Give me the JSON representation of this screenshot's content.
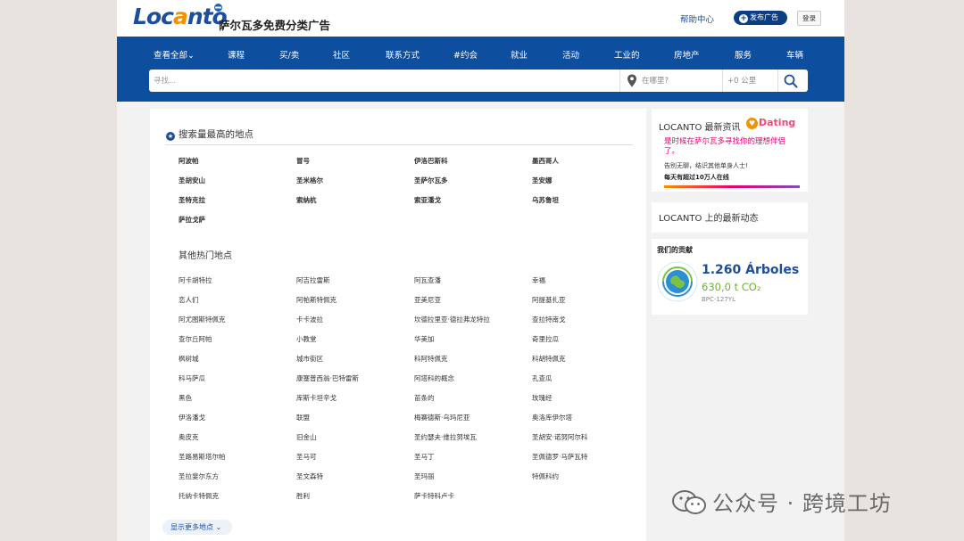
{
  "header": {
    "logo_text_a": "Loc",
    "logo_text_b": "a",
    "logo_text_c": "nto",
    "tagline": "萨尔瓦多免费分类广告",
    "help_link": "帮助中心",
    "post_ad_label": "发布广告",
    "login_label": "登录"
  },
  "nav": {
    "items": [
      "查看全部",
      "课程",
      "买/卖",
      "社区",
      "联系方式",
      "#约会",
      "就业",
      "活动",
      "工业的",
      "房地产",
      "服务",
      "车辆"
    ]
  },
  "search": {
    "query_placeholder": "寻找...",
    "location_placeholder": "在哪里?",
    "radius_label": "+0 公里"
  },
  "popular": {
    "title": "搜索量最高的地点",
    "places": [
      "阿波帕",
      "冒号",
      "伊洛巴斯科",
      "墨西哥人",
      "圣胡安山",
      "圣米格尔",
      "圣萨尔瓦多",
      "圣安娜",
      "圣特克拉",
      "索纳杭",
      "索亚潘戈",
      "乌苏鲁坦",
      "萨拉戈萨"
    ]
  },
  "other": {
    "title": "其他热门地点",
    "places": [
      "阿卡胡特拉",
      "阿吉拉雷斯",
      "阿瓦查潘",
      "幸福",
      "恋人们",
      "阿帕斯特佩克",
      "亚美尼亚",
      "阿提基扎亚",
      "阿尤图斯特佩克",
      "卡卡波拉",
      "坎德拉里亚·德拉弗龙特拉",
      "查拉特南戈",
      "查尔丘阿帕",
      "小教堂",
      "华美加",
      "奇里拉瓜",
      "枫树城",
      "城市街区",
      "科阿特佩克",
      "科胡特佩克",
      "科马萨瓜",
      "康塞普西翁·巴特雷斯",
      "阿塔科的概念",
      "孔查瓜",
      "黑色",
      "库斯卡坦辛戈",
      "苗条的",
      "玫瑰经",
      "伊洛潘戈",
      "联盟",
      "梅赛德斯·乌玛尼亚",
      "奥洛库伊尔塔",
      "奥皮克",
      "旧金山",
      "圣约瑟夫·维拉努埃瓦",
      "圣胡安·诺努阿尔科",
      "圣路易斯塔尔帕",
      "圣马可",
      "圣马丁",
      "圣佩德罗·马萨瓦特",
      "圣拉斐尔东方",
      "圣文森特",
      "圣玛丽",
      "特佩科约",
      "托纳卡特佩克",
      "胜利",
      "萨卡特科卢卡",
      ""
    ],
    "more_label": "显示更多地点"
  },
  "sidebar": {
    "news_title": "LOCANTO 最新资讯",
    "dating_brand": "Dating",
    "dating_headline": "是时候在萨尔瓦多寻找你的理想伴侣了。",
    "dating_line1": "告别无聊，结识其他单身人士!",
    "dating_line2": "每天有超过10万人在线",
    "activity_title": "LOCANTO 上的最新动态",
    "contrib_title": "我们的贡献",
    "trees": "1.260 Árboles",
    "co2": "630,0 t CO₂",
    "cert_code": "BPC-127YL"
  },
  "watermark": {
    "text": "公众号 · 跨境工坊"
  },
  "colors": {
    "brand_blue": "#0d4e9f",
    "logo_orange": "#f39200",
    "dating_pink": "#e4006c",
    "co2_green": "#6ab42d"
  }
}
